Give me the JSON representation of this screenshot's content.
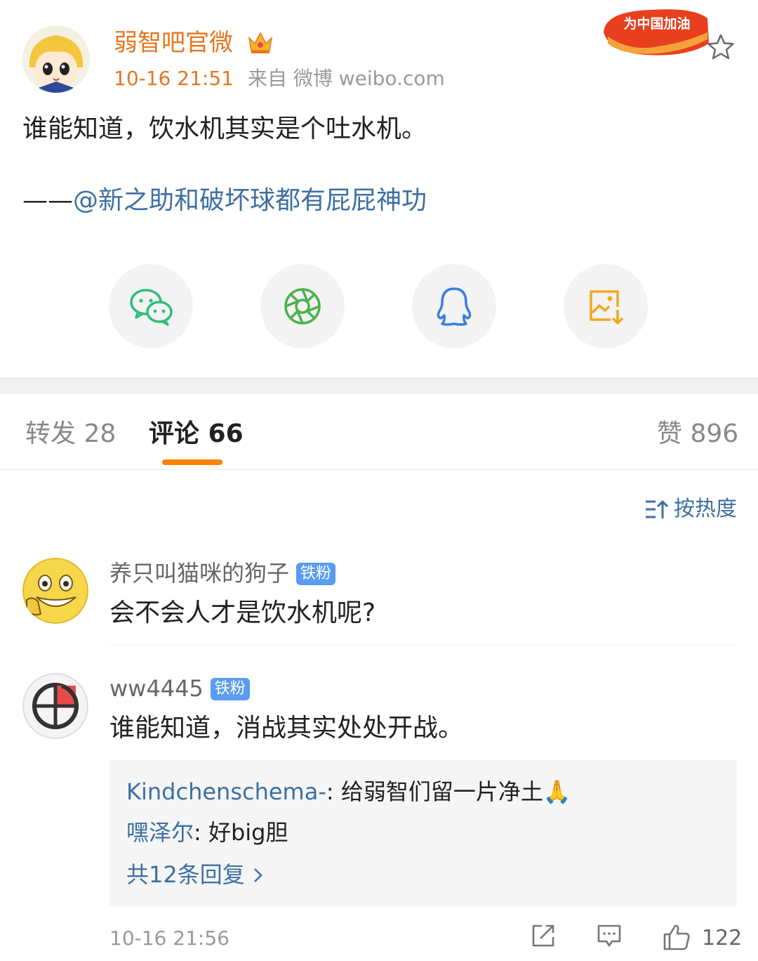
{
  "post": {
    "author": "弱智吧官微",
    "time": "10-16 21:51",
    "source": "来自 微博 weibo.com",
    "badge_text": "为中国加油",
    "content": "谁能知道，饮水机其实是个吐水机。",
    "quote_dash": "——",
    "quote_mention": "@新之助和破坏球都有屁屁神功"
  },
  "share": [
    {
      "name": "wechat-icon"
    },
    {
      "name": "moments-icon"
    },
    {
      "name": "qq-icon"
    },
    {
      "name": "save-image-icon"
    }
  ],
  "tabs": {
    "repost": "转发 28",
    "comments": "评论 66",
    "likes": "赞 896"
  },
  "sort_label": "按热度",
  "comments": [
    {
      "user": "养只叫猫咪的狗子",
      "badge": "铁粉",
      "text": "会不会人才是饮水机呢?"
    },
    {
      "user": "ww4445",
      "badge": "铁粉",
      "text": "谁能知道，消战其实处处开战。",
      "replies": [
        {
          "user": "Kindchenschema-",
          "text": ": 给弱智们留一片净土🙏"
        },
        {
          "user": "嘿泽尔",
          "text": ": 好big胆"
        }
      ],
      "more_replies": "共12条回复 ",
      "time": "10-16 21:56",
      "like_count": "122"
    }
  ],
  "colors": {
    "accent_orange": "#ff8200",
    "link_blue": "#3d6fa3",
    "fan_badge": "#5a9cf0"
  }
}
